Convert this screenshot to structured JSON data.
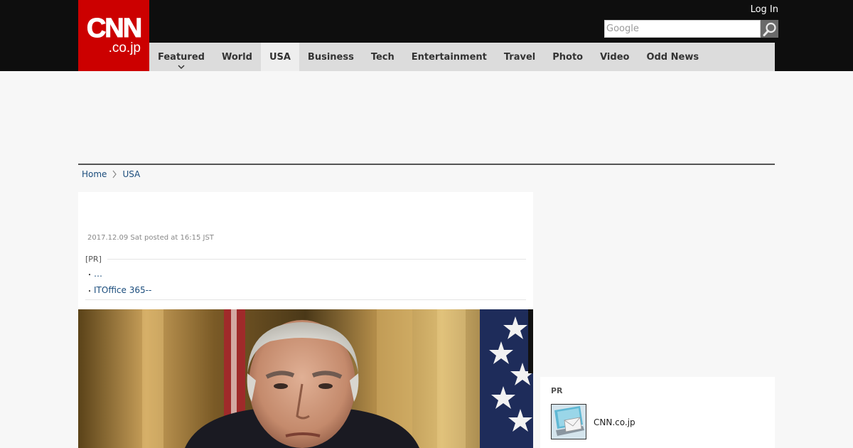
{
  "header": {
    "logo_main": "CNN",
    "logo_sub": ".co.jp",
    "login_label": "Log In",
    "search": {
      "placeholder": "Google"
    }
  },
  "nav": {
    "items": [
      {
        "label": "Featured"
      },
      {
        "label": "World"
      },
      {
        "label": "USA"
      },
      {
        "label": "Business"
      },
      {
        "label": "Tech"
      },
      {
        "label": "Entertainment"
      },
      {
        "label": "Travel"
      },
      {
        "label": "Photo"
      },
      {
        "label": "Video"
      },
      {
        "label": "Odd News"
      }
    ],
    "active": "USA"
  },
  "breadcrumb": {
    "home": "Home",
    "current": "USA"
  },
  "article": {
    "date": "2017.12.09 Sat posted at 16:15 JST",
    "pr_label": "[PR]",
    "pr_links": [
      {
        "bullet": "・",
        "text": "…"
      },
      {
        "bullet": "・",
        "text": "ITOffice 365--"
      }
    ]
  },
  "sidebar": {
    "pr_label": "PR",
    "pr_item_text": "CNN.co.jp"
  },
  "colors": {
    "brand_red": "#cc0000",
    "topbar": "#0e0e0e",
    "nav_bg": "#dcdcdc",
    "link": "#1a4c7c"
  }
}
